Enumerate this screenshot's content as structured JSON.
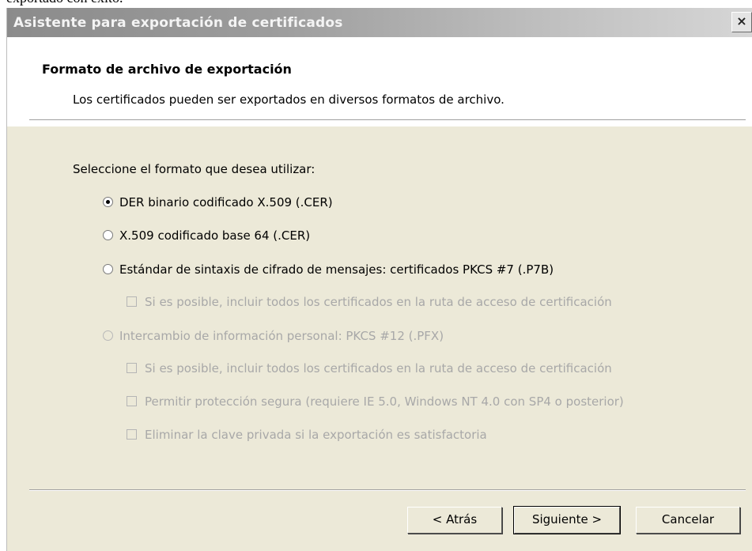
{
  "background_fragment": "exportado con éxito.",
  "window": {
    "title": "Asistente para exportación de certificados",
    "close_glyph": "×"
  },
  "header": {
    "heading": "Formato de archivo de exportación",
    "description": "Los certificados pueden ser exportados en diversos formatos de archivo."
  },
  "body": {
    "prompt": "Seleccione el formato que desea utilizar:",
    "options": [
      {
        "label": "DER binario codificado X.509 (.CER)",
        "type": "radio",
        "checked": true,
        "enabled": true
      },
      {
        "label": "X.509 codificado base 64 (.CER)",
        "type": "radio",
        "checked": false,
        "enabled": true
      },
      {
        "label": "Estándar de sintaxis de cifrado de mensajes: certificados PKCS #7 (.P7B)",
        "type": "radio",
        "checked": false,
        "enabled": true
      },
      {
        "label": "Si es posible, incluir todos los certificados en la ruta de acceso de certificación",
        "type": "checkbox",
        "checked": false,
        "enabled": false
      },
      {
        "label": "Intercambio de información personal: PKCS #12 (.PFX)",
        "type": "radio",
        "checked": false,
        "enabled": false
      },
      {
        "label": "Si es posible, incluir todos los certificados en la ruta de acceso de certificación",
        "type": "checkbox",
        "checked": false,
        "enabled": false
      },
      {
        "label": "Permitir protección segura (requiere IE 5.0, Windows NT 4.0 con SP4 o posterior)",
        "type": "checkbox",
        "checked": false,
        "enabled": false
      },
      {
        "label": "Eliminar la clave privada si la exportación es satisfactoria",
        "type": "checkbox",
        "checked": false,
        "enabled": false
      }
    ]
  },
  "buttons": {
    "back": "< Atrás",
    "next": "Siguiente >",
    "cancel": "Cancelar"
  }
}
